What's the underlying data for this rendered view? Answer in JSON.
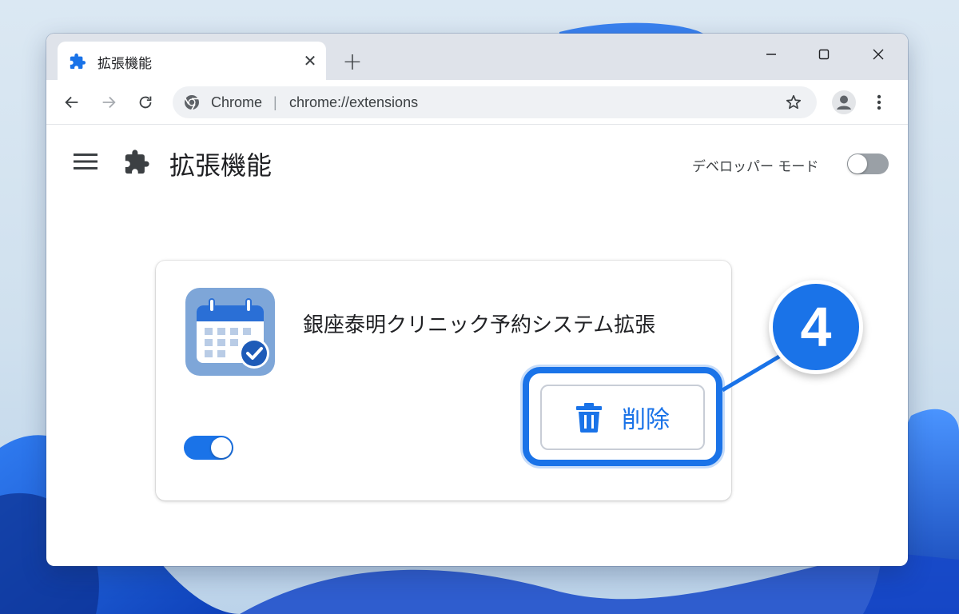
{
  "tab": {
    "title": "拡張機能",
    "close_icon": "close-icon",
    "new_tab_icon": "plus-icon"
  },
  "window_controls": [
    "minimize-icon",
    "maximize-icon",
    "close-icon"
  ],
  "omnibox": {
    "site_label": "Chrome",
    "separator": "|",
    "url": "chrome://extensions"
  },
  "page": {
    "title": "拡張機能",
    "developer_mode_label": "デベロッパー モード",
    "developer_mode_on": false
  },
  "extension": {
    "name": "銀座泰明クリニック予約システム拡張",
    "enabled": true,
    "remove_label": "削除",
    "icon": "calendar-check-icon"
  },
  "annotation": {
    "step": "4"
  },
  "colors": {
    "accent": "#1a73e8",
    "toggle_off": "#9aa0a6"
  }
}
